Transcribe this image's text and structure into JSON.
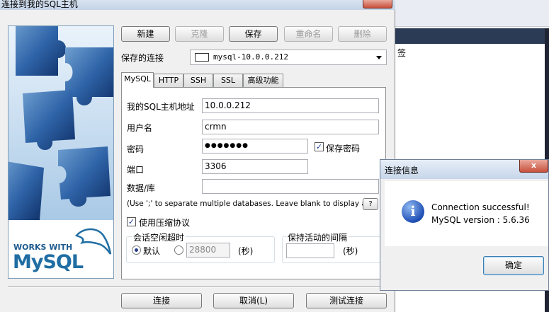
{
  "window": {
    "title": "连接到我的SQL主机"
  },
  "toolbar": {
    "new": "新建",
    "clone": "克隆",
    "save": "保存",
    "rename": "重命名",
    "delete": "删除"
  },
  "saved": {
    "label": "保存的连接",
    "value": "mysql-10.0.0.212"
  },
  "tabs": [
    {
      "label": "MySQL",
      "active": true
    },
    {
      "label": "HTTP"
    },
    {
      "label": "SSH"
    },
    {
      "label": "SSL"
    },
    {
      "label": "高级功能"
    }
  ],
  "form": {
    "host_label": "我的SQL主机地址",
    "host_value": "10.0.0.212",
    "user_label": "用户名",
    "user_value": "crmn",
    "pass_label": "密码",
    "pass_value": "●●●●●●●",
    "save_pass_label": "保存密码",
    "port_label": "端口",
    "port_value": "3306",
    "db_label": "数据/库",
    "db_value": "",
    "db_hint": "(Use ';' to separate multiple databases. Leave blank to display all)",
    "help_btn": "?",
    "compress_label": "使用压缩协议",
    "timeout_group": "会话空闲超时",
    "default_label": "默认",
    "timeout_value": "28800",
    "seconds": "(秒)",
    "keepalive_group": "保持活动的间隔",
    "keepalive_value": "",
    "seconds2": "(秒)"
  },
  "footer": {
    "connect": "连接",
    "cancel": "取消(L)",
    "test": "测试连接"
  },
  "logo": {
    "works_with": "WORKS WITH",
    "brand": "MySQL"
  },
  "background": {
    "right_text": "签"
  },
  "info": {
    "title": "连接信息",
    "line1": "Connection successful!",
    "line2": "MySQL version : 5.6.36",
    "ok": "确定",
    "icon_glyph": "i",
    "close_glyph": "x"
  }
}
